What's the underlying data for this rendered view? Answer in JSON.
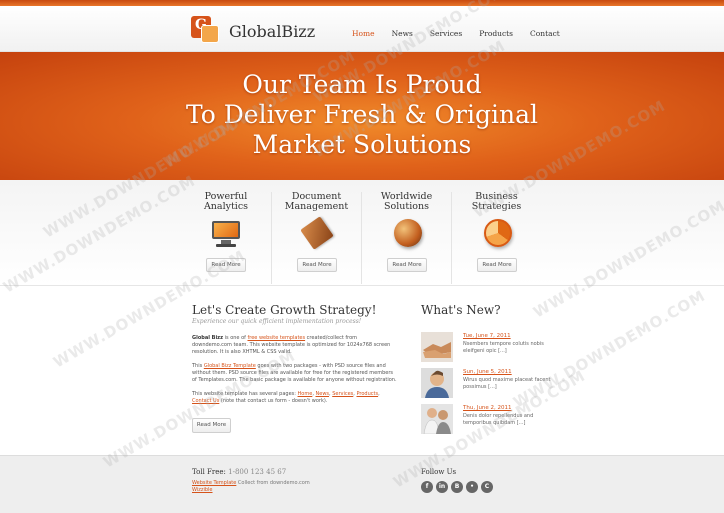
{
  "header": {
    "logo_letter": "G",
    "brand": "GlobalBizz",
    "nav": [
      {
        "label": "Home",
        "active": true
      },
      {
        "label": "News",
        "active": false
      },
      {
        "label": "Services",
        "active": false
      },
      {
        "label": "Products",
        "active": false
      },
      {
        "label": "Contact",
        "active": false
      }
    ]
  },
  "hero": {
    "headline": "Our Team Is Proud\nTo Deliver Fresh & Original\nMarket Solutions"
  },
  "features": [
    {
      "title": "Powerful\nAnalytics",
      "icon": "monitor-icon",
      "button": "Read More"
    },
    {
      "title": "Document\nManagement",
      "icon": "notebook-icon",
      "button": "Read More"
    },
    {
      "title": "Worldwide\nSolutions",
      "icon": "globe-icon",
      "button": "Read More"
    },
    {
      "title": "Business\nStrategies",
      "icon": "pie-chart-icon",
      "button": "Read More"
    }
  ],
  "main": {
    "title": "Let's Create Growth Strategy!",
    "subtitle": "Experience our quick efficient implementation process!",
    "p1_bold": "Global Bizz",
    "p1_a": " is one of ",
    "p1_link": "free website templates",
    "p1_b": " created/collect from downdemo.com team. This website template is optimized for 1024x768 screen resolution. It is also XHTML & CSS valid.",
    "p2_a": "This ",
    "p2_link": "Global Bizz Template",
    "p2_b": " goes with two packages - with PSD source files and without them. PSD source files are available for free for the registered members of Templates.com. The basic package is available for anyone without registration.",
    "p3_a": "This website template has several pages: ",
    "p3_links": [
      "Home",
      "News",
      "Services",
      "Products",
      "Contact Us"
    ],
    "p3_b": " (note that contact us form - doesn't work).",
    "read_more": "Read More"
  },
  "news": {
    "title": "What's New?",
    "items": [
      {
        "date": "Tue, June 7, 2011",
        "text": "Nsembers tempore colutis nobis eleifgeni opic",
        "more": "[...]",
        "image": "handshake-photo"
      },
      {
        "date": "Sun, June 5, 2011",
        "text": "Wirus quod maxime placeat facent possimus",
        "more": "[...]",
        "image": "man-photo"
      },
      {
        "date": "Thu, June 2, 2011",
        "text": "Denis dolor repellendus and temporibus quibdam",
        "more": "[...]",
        "image": "people-photo"
      }
    ]
  },
  "footer": {
    "toll_label": "Toll Free:",
    "toll_number": "1-800 123 45 67",
    "link1": "Website Template",
    "link1_after": " Collect from downdemo.com",
    "link2": "Wizzible",
    "follow": "Follow Us",
    "socials": [
      {
        "name": "facebook-icon",
        "glyph": "f"
      },
      {
        "name": "linkedin-icon",
        "glyph": "in"
      },
      {
        "name": "blogger-icon",
        "glyph": "B"
      },
      {
        "name": "flickr-icon",
        "glyph": "•"
      },
      {
        "name": "chrome-icon",
        "glyph": "C"
      }
    ]
  },
  "watermark": "WWW.DOWNDEMO.COM"
}
